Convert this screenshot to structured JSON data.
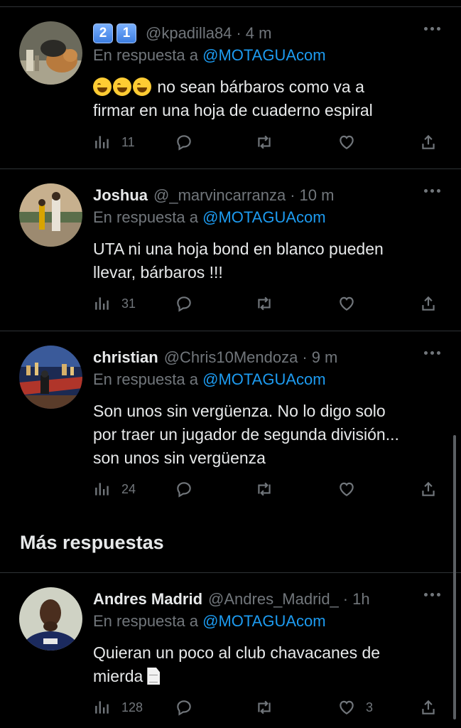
{
  "tweets": [
    {
      "badges": [
        "2",
        "1"
      ],
      "name": "",
      "handle": "@kpadilla84",
      "time": "4 m",
      "reply_prefix": "En respuesta a",
      "reply_mention": "@MOTAGUAcom",
      "text_lines": [
        "no sean bárbaros como va a",
        "firmar en una hoja de cuaderno espiral"
      ],
      "emoji_count": 3,
      "views": "11",
      "replies": "",
      "retweets": "",
      "likes": ""
    },
    {
      "name": "Joshua",
      "handle": "@_marvincarranza",
      "time": "10 m",
      "reply_prefix": "En respuesta a",
      "reply_mention": "@MOTAGUAcom",
      "text_lines": [
        "UTA ni una hoja bond en blanco pueden",
        "llevar, bárbaros !!!"
      ],
      "views": "31",
      "likes": ""
    },
    {
      "name": "christian",
      "handle": "@Chris10Mendoza",
      "time": "9 m",
      "reply_prefix": "En respuesta a",
      "reply_mention": "@MOTAGUAcom",
      "text_lines": [
        "Son unos sin vergüenza. No lo digo solo",
        "por traer un jugador de segunda división...",
        "son unos sin vergüenza"
      ],
      "views": "24",
      "likes": ""
    },
    {
      "name": "Andres Madrid",
      "handle": "@Andres_Madrid_",
      "time": "1h",
      "reply_prefix": "En respuesta a",
      "reply_mention": "@MOTAGUAcom",
      "text_lines": [
        "Quieran un poco al club chavacanes de",
        "mierda"
      ],
      "views": "128",
      "likes": "3"
    }
  ],
  "section_title": "Más respuestas",
  "colors": {
    "background": "#000000",
    "text": "#e7e9ea",
    "muted": "#71767b",
    "link": "#1d9bf0",
    "divider": "#2f3336"
  },
  "icons": [
    "views-icon",
    "reply-icon",
    "retweet-icon",
    "like-icon",
    "share-icon",
    "more-icon"
  ]
}
